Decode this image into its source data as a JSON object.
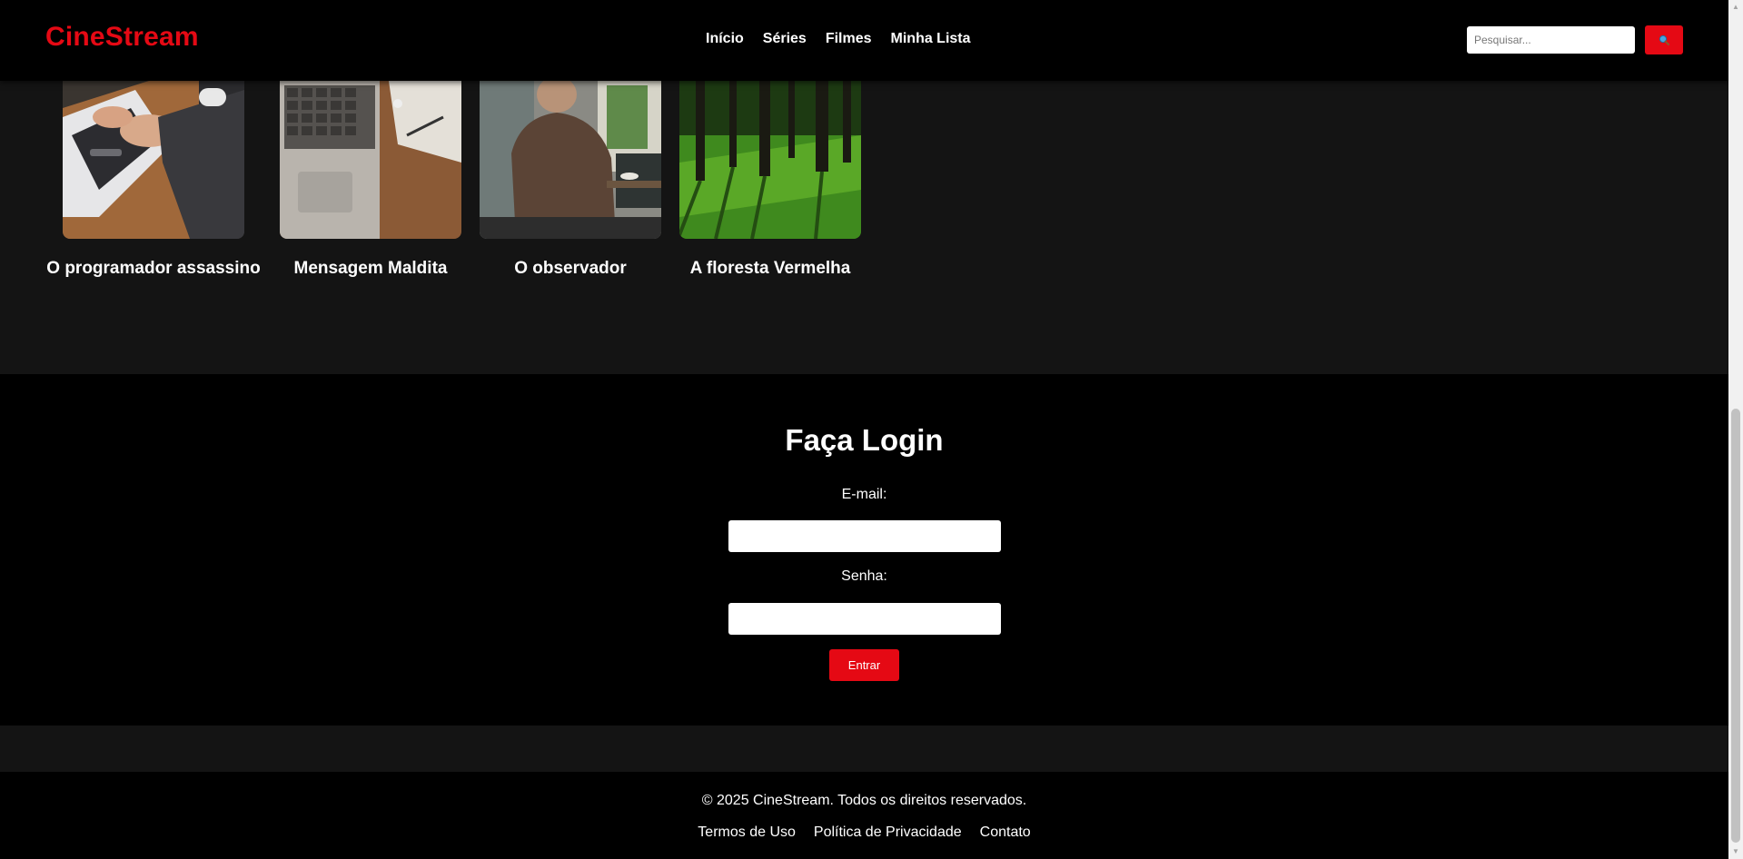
{
  "header": {
    "logo": "CineStream",
    "nav": [
      "Início",
      "Séries",
      "Filmes",
      "Minha Lista"
    ],
    "search_placeholder": "Pesquisar...",
    "search_button_icon": "search-icon"
  },
  "movies": [
    {
      "title": "O programador assassino",
      "image": "hands typing on laptop"
    },
    {
      "title": "Mensagem Maldita",
      "image": "laptop on wooden desk"
    },
    {
      "title": "O observador",
      "image": "man seen from behind in cafe"
    },
    {
      "title": "A floresta Vermelha",
      "image": "sunlit forest with green moss"
    }
  ],
  "login": {
    "title": "Faça Login",
    "email_label": "E-mail:",
    "password_label": "Senha:",
    "submit_label": "Entrar"
  },
  "footer": {
    "copyright": "© 2025 CineStream. Todos os direitos reservados.",
    "links": [
      "Termos de Uso",
      "Política de Privacidade",
      "Contato"
    ]
  },
  "colors": {
    "accent": "#e50914",
    "header_bg": "#000000",
    "page_bg": "#141414"
  }
}
